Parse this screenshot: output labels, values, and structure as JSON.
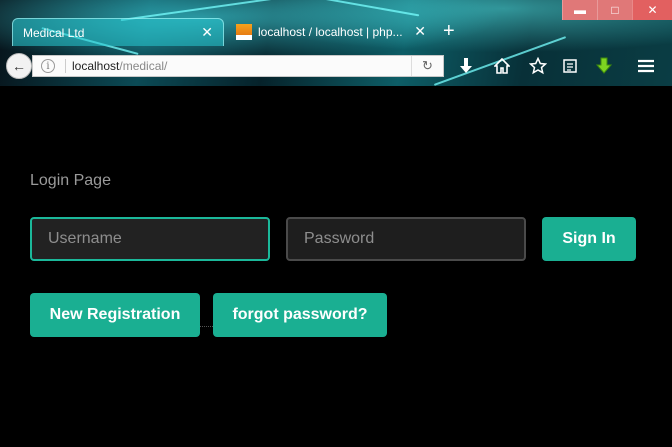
{
  "browser": {
    "tabs": [
      {
        "label": "Medical Ltd",
        "active": true
      },
      {
        "label": "localhost / localhost | php...",
        "active": false
      }
    ],
    "new_tab_symbol": "+",
    "tab_close_symbol": "✕",
    "url_host": "localhost",
    "url_path": "/medical/",
    "toolbar_icons": [
      "download-icon",
      "home-icon",
      "bookmark-star-icon",
      "reading-list-icon",
      "addon-download-icon",
      "menu-icon"
    ],
    "window_controls": {
      "minimize": "▬",
      "maximize": "□",
      "close": "✕"
    }
  },
  "page": {
    "title": "Login Page",
    "username_placeholder": "Username",
    "password_placeholder": "Password",
    "signin_label": "Sign In",
    "register_label": "New Registration",
    "forgot_label": "forgot password?"
  },
  "colors": {
    "accent": "#1aaf92",
    "page_background": "#000000",
    "focus_border": "#1bb89a"
  }
}
